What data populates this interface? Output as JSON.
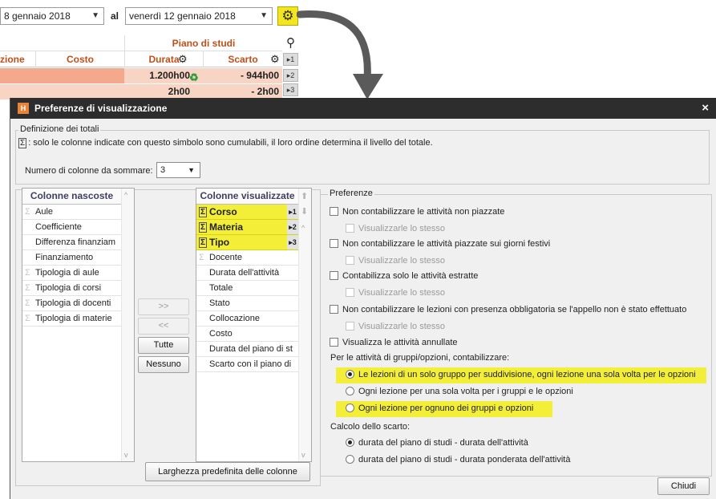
{
  "background": {
    "date_from": "8 gennaio 2018",
    "al_label": "al",
    "date_to": "venerdì 12 gennaio 2018",
    "table": {
      "group_header": "Piano di studi",
      "columns": [
        "zione",
        "Costo",
        "Durata",
        "Scarto"
      ],
      "rows": [
        {
          "durata": "1.200h00",
          "scarto": "- 944h00"
        },
        {
          "durata": "2h00",
          "scarto": "- 2h00"
        }
      ],
      "side_buttons": [
        "▸1",
        "▸2",
        "▸3"
      ]
    }
  },
  "dialog": {
    "title": "Preferenze di visualizzazione",
    "close": "×",
    "totals_group": {
      "title": "Definizione dei totali",
      "note": ": solo le colonne indicate con questo simbolo sono cumulabili, il loro ordine determina il livello del totale.",
      "count_label": "Numero di colonne da sommare:",
      "count_value": "3"
    },
    "hidden_columns": {
      "header": "Colonne nascoste",
      "items": [
        {
          "label": "Aule",
          "sigma": true
        },
        {
          "label": "Coefficiente",
          "sigma": false
        },
        {
          "label": "Differenza finanziam",
          "sigma": false
        },
        {
          "label": "Finanziamento",
          "sigma": false
        },
        {
          "label": "Tipologia di aule",
          "sigma": true
        },
        {
          "label": "Tipologia di corsi",
          "sigma": true
        },
        {
          "label": "Tipologia di docenti",
          "sigma": true
        },
        {
          "label": "Tipologia di materie",
          "sigma": true
        }
      ]
    },
    "move_buttons": {
      "add": ">>",
      "remove": "<<",
      "all": "Tutte",
      "none": "Nessuno"
    },
    "visible_columns": {
      "header": "Colonne visualizzate",
      "items": [
        {
          "label": "Corso",
          "sigma": true,
          "selected": true,
          "level": "▸1"
        },
        {
          "label": "Materia",
          "sigma": true,
          "selected": true,
          "level": "▸2"
        },
        {
          "label": "Tipo",
          "sigma": true,
          "selected": true,
          "level": "▸3"
        },
        {
          "label": "Docente",
          "sigma": true,
          "selected": false,
          "level": ""
        },
        {
          "label": "Durata dell'attività",
          "sigma": false,
          "selected": false,
          "level": ""
        },
        {
          "label": "Totale",
          "sigma": false,
          "selected": false,
          "level": ""
        },
        {
          "label": "Stato",
          "sigma": false,
          "selected": false,
          "level": ""
        },
        {
          "label": "Collocazione",
          "sigma": false,
          "selected": false,
          "level": ""
        },
        {
          "label": "Costo",
          "sigma": false,
          "selected": false,
          "level": ""
        },
        {
          "label": "Durata del piano di st",
          "sigma": false,
          "selected": false,
          "level": ""
        },
        {
          "label": "Scarto con il piano di",
          "sigma": false,
          "selected": false,
          "level": ""
        }
      ]
    },
    "default_width_button": "Larghezza predefinita delle colonne",
    "preferences": {
      "title": "Preferenze",
      "options": [
        {
          "label": "Non contabilizzare le attività non piazzate",
          "checked": false,
          "disabled": false
        },
        {
          "label": "Visualizzarle lo stesso",
          "checked": false,
          "disabled": true
        },
        {
          "label": "Non contabilizzare le attività piazzate sui giorni festivi",
          "checked": false,
          "disabled": false
        },
        {
          "label": "Visualizzarle lo stesso",
          "checked": false,
          "disabled": true
        },
        {
          "label": "Contabilizza solo le attività estratte",
          "checked": false,
          "disabled": false
        },
        {
          "label": "Visualizzarle lo stesso",
          "checked": false,
          "disabled": true
        },
        {
          "label": "Non contabilizzare le lezioni con presenza obbligatoria se l'appello non è stato effettuato",
          "checked": false,
          "disabled": false
        },
        {
          "label": "Visualizzarle lo stesso",
          "checked": false,
          "disabled": true
        },
        {
          "label": "Visualizza le attività annullate",
          "checked": false,
          "disabled": false
        }
      ],
      "groups_label": "Per le attività di gruppi/opzioni, contabilizzare:",
      "groups_options": [
        {
          "label": "Le lezioni di un solo gruppo per suddivisione, ogni lezione una sola volta per le opzioni",
          "selected": true,
          "highlight": true
        },
        {
          "label": "Ogni lezione per una sola volta per i gruppi e le opzioni",
          "selected": false,
          "highlight": false
        },
        {
          "label": "Ogni lezione per ognuno dei gruppi e opzioni",
          "selected": false,
          "highlight": true
        }
      ],
      "gap_label": "Calcolo dello scarto:",
      "gap_options": [
        {
          "label": "durata del piano di studi - durata dell'attività",
          "selected": true
        },
        {
          "label": "durata del piano di studi - durata ponderata dell'attività",
          "selected": false
        }
      ]
    },
    "close_button": "Chiudi"
  }
}
